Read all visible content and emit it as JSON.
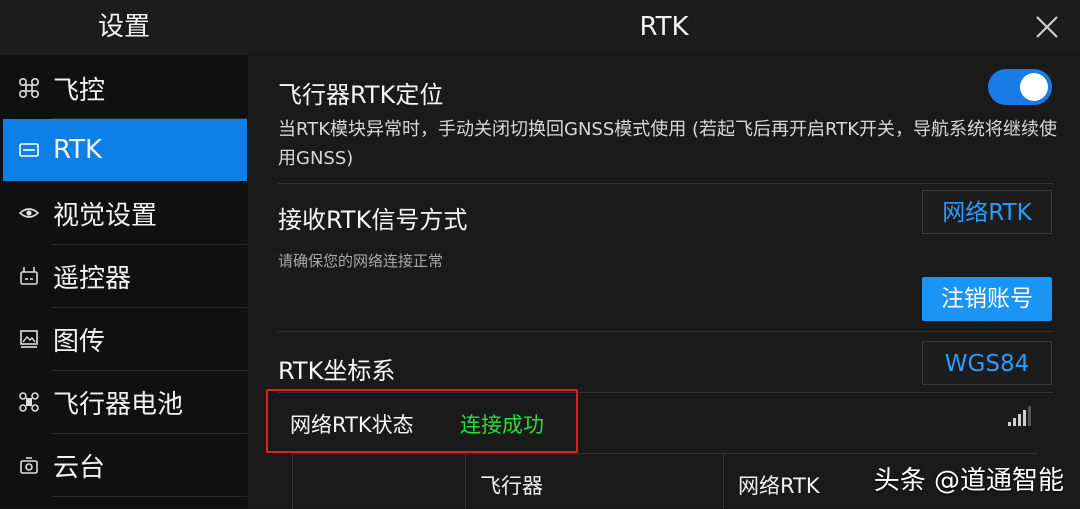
{
  "header": {
    "left_title": "设置",
    "title": "RTK",
    "close_icon": "close-icon"
  },
  "sidebar": {
    "items": [
      {
        "label": "飞控",
        "icon": "drone-icon",
        "active": false
      },
      {
        "label": "RTK",
        "icon": "rtk-icon",
        "active": true
      },
      {
        "label": "视觉设置",
        "icon": "eye-icon",
        "active": false
      },
      {
        "label": "遥控器",
        "icon": "remote-controller-icon",
        "active": false
      },
      {
        "label": "图传",
        "icon": "image-transmission-icon",
        "active": false
      },
      {
        "label": "飞行器电池",
        "icon": "aircraft-battery-icon",
        "active": false
      },
      {
        "label": "云台",
        "icon": "gimbal-camera-icon",
        "active": false
      }
    ]
  },
  "rtk_positioning": {
    "title": "飞行器RTK定位",
    "enabled": true,
    "description": "当RTK模块异常时，手动关闭切换回GNSS模式使用 (若起飞后再开启RTK开关，导航系统将继续使用GNSS)"
  },
  "signal_method": {
    "title": "接收RTK信号方式",
    "value": "网络RTK",
    "hint": "请确保您的网络连接正常",
    "logout_button": "注销账号"
  },
  "coordinate_system": {
    "title": "RTK坐标系",
    "value": "WGS84"
  },
  "network_status": {
    "label": "网络RTK状态",
    "value": "连接成功",
    "icon": "signal-strength-icon"
  },
  "status_table": {
    "columns": [
      "飞行器",
      "网络RTK"
    ]
  },
  "watermark": "头条 @道通智能",
  "colors": {
    "accent": "#0c80e6",
    "link": "#2b9bff",
    "success": "#2ddc3a",
    "highlight_border": "#e21f26"
  }
}
